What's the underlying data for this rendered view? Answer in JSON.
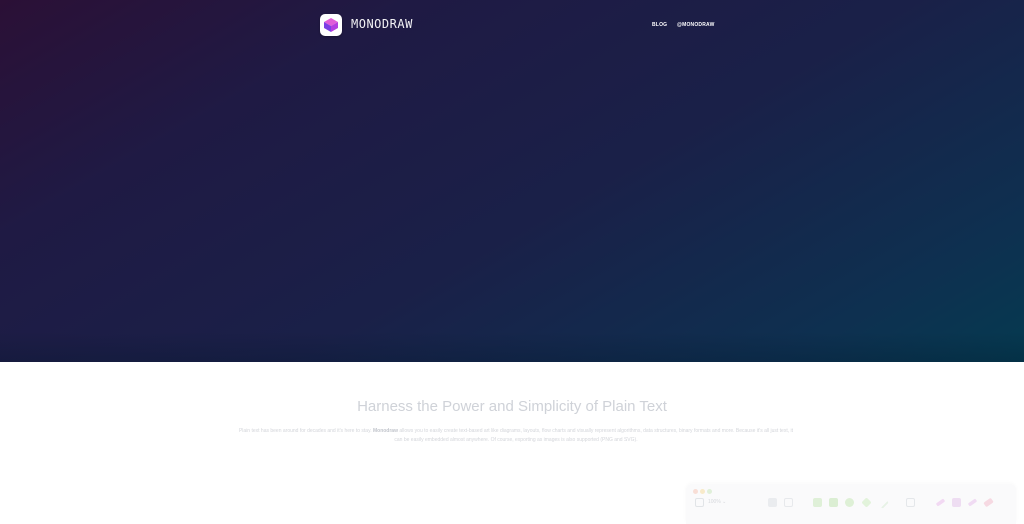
{
  "header": {
    "brand": "MONODRAW",
    "nav": [
      {
        "label": "BLOG"
      },
      {
        "label": "@MONODRAW"
      }
    ]
  },
  "main": {
    "headline": "Harness the Power and Simplicity of Plain Text",
    "intro_before": "Plain text has been around for decades and it's here to stay. ",
    "intro_bold": "Monodraw",
    "intro_after": " allows you to easily create text-based art like diagrams, layouts, flow charts and visually represent algorithms, data structures, binary formats and more. Because it's all just text, it can be easily embedded almost anywhere. Of course, exporting as images is also supported (PNG and SVG)."
  },
  "app_preview": {
    "zoom_label": "100% ⌄"
  },
  "colors": {
    "hero_top_left": "#2b1036",
    "hero_bottom_right": "#053a50",
    "logo_magenta": "#c23ae0",
    "logo_violet": "#6a3fe0"
  }
}
